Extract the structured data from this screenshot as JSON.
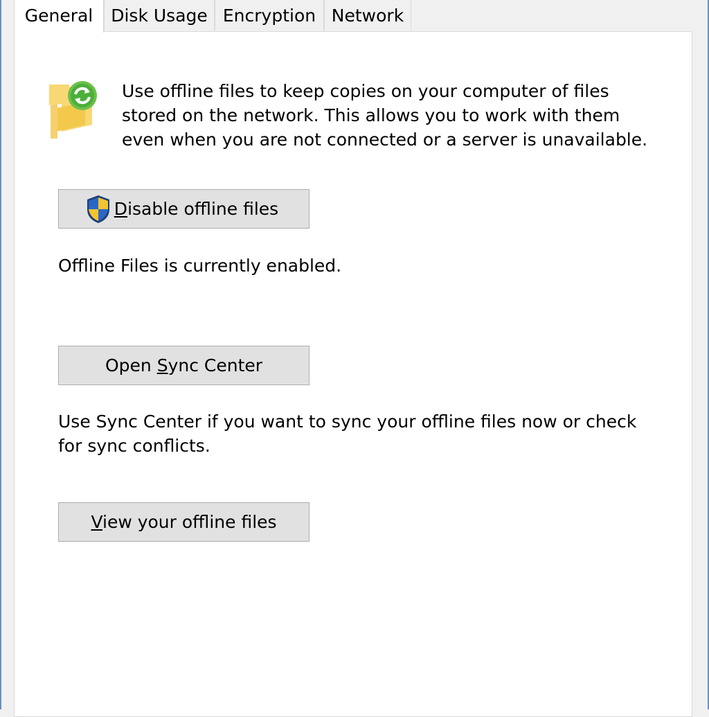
{
  "tabs": [
    {
      "label": "General",
      "selected": true
    },
    {
      "label": "Disk Usage",
      "selected": false
    },
    {
      "label": "Encryption",
      "selected": false
    },
    {
      "label": "Network",
      "selected": false
    }
  ],
  "general": {
    "intro_text": "Use offline files to keep copies on your computer of files\nstored on the network.  This allows you to work with them\neven when you are not connected or a server is unavailable.",
    "icons": {
      "intro": "offline-folder-sync-icon",
      "disable_button": "uac-shield-icon"
    },
    "disable_button": {
      "mnemonic": "D",
      "rest": "isable offline files"
    },
    "status_text": "Offline Files is currently enabled.",
    "sync_button": {
      "before": "Open ",
      "mnemonic": "S",
      "after": "ync Center"
    },
    "sync_description": "Use Sync Center if you want to sync your offline files now or check\nfor sync conflicts.",
    "view_button": {
      "mnemonic": "V",
      "rest": "iew your offline files"
    }
  },
  "colors": {
    "window_edge": "#6b8fbf",
    "button_face": "#e1e1e1",
    "button_border": "#adadad",
    "sync_badge": "#6cc04a",
    "folder": "#f8d775"
  }
}
